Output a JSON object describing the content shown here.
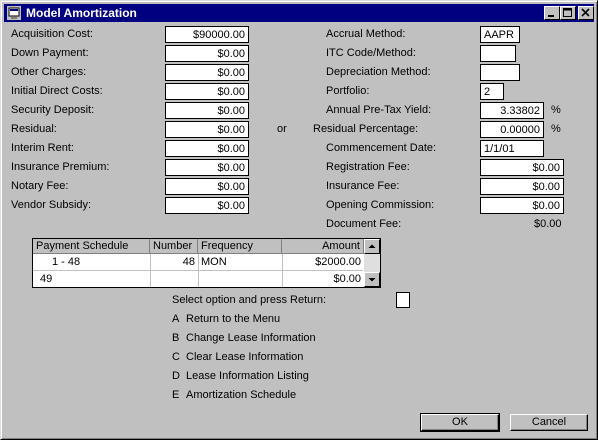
{
  "window": {
    "title": "Model Amortization"
  },
  "left_fields": [
    {
      "label": "Acquisition Cost:",
      "value": "$90000.00"
    },
    {
      "label": "Down Payment:",
      "value": "$0.00"
    },
    {
      "label": "Other Charges:",
      "value": "$0.00"
    },
    {
      "label": "Initial Direct Costs:",
      "value": "$0.00"
    },
    {
      "label": "Security Deposit:",
      "value": "$0.00"
    },
    {
      "label": "Residual:",
      "value": "$0.00"
    },
    {
      "label": "Interim Rent:",
      "value": "$0.00"
    },
    {
      "label": "Insurance Premium:",
      "value": "$0.00"
    },
    {
      "label": "Notary Fee:",
      "value": "$0.00"
    },
    {
      "label": "Vendor Subsidy:",
      "value": "$0.00"
    }
  ],
  "or_label": "or",
  "right_fields": [
    {
      "label": "Accrual Method:",
      "value": "AAPR"
    },
    {
      "label": "ITC Code/Method:",
      "value": ""
    },
    {
      "label": "Depreciation Method:",
      "value": ""
    },
    {
      "label": "Portfolio:",
      "value": "2"
    },
    {
      "label": "Annual Pre-Tax Yield:",
      "value": "3.33802",
      "suffix": "%"
    },
    {
      "label": "Residual Percentage:",
      "value": "0.00000",
      "suffix": "%"
    },
    {
      "label": "Commencement Date:",
      "value": "1/1/01"
    },
    {
      "label": "Registration Fee:",
      "value": "$0.00"
    },
    {
      "label": "Insurance Fee:",
      "value": "$0.00"
    },
    {
      "label": "Opening Commission:",
      "value": "$0.00"
    },
    {
      "label": "Document Fee:",
      "value": "$0.00"
    }
  ],
  "schedule": {
    "headers": [
      "Payment Schedule",
      "Number",
      "Frequency",
      "Amount"
    ],
    "rows": [
      {
        "schedule": "1 -  48",
        "number": "48",
        "frequency": "MON",
        "amount": "$2000.00"
      },
      {
        "schedule": "49",
        "number": "",
        "frequency": "",
        "amount": "$0.00"
      }
    ]
  },
  "options": {
    "prompt": "Select option and press Return:",
    "items": [
      {
        "key": "A",
        "label": "Return to the Menu"
      },
      {
        "key": "B",
        "label": "Change Lease Information"
      },
      {
        "key": "C",
        "label": "Clear Lease Information"
      },
      {
        "key": "D",
        "label": "Lease Information Listing"
      },
      {
        "key": "E",
        "label": "Amortization Schedule"
      }
    ]
  },
  "buttons": {
    "ok": "OK",
    "cancel": "Cancel"
  },
  "colors": {
    "titlebar": "#000080",
    "face": "#c0c0c0",
    "field": "#ffffff"
  },
  "icons": [
    "app-icon",
    "minimize-icon",
    "maximize-icon",
    "close-icon",
    "scroll-up-icon",
    "scroll-down-icon"
  ]
}
